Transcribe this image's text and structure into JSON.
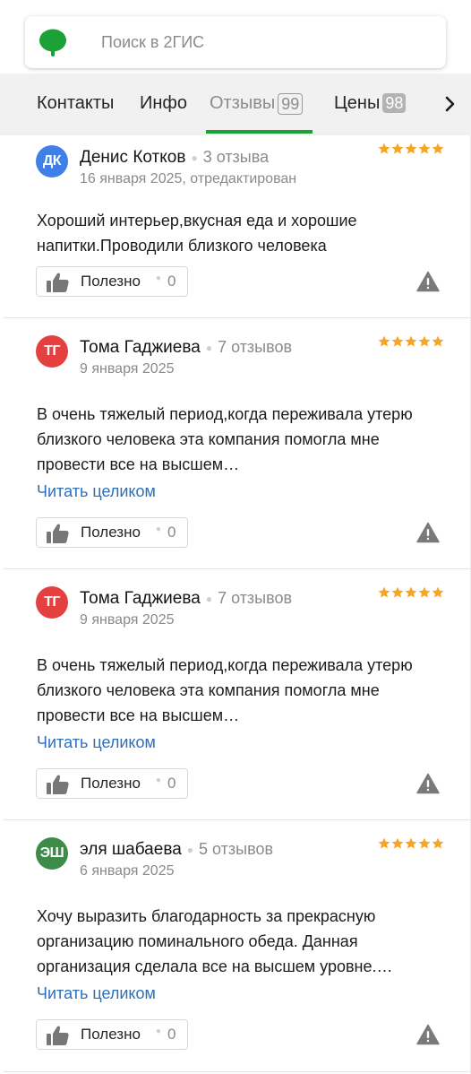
{
  "search": {
    "placeholder": "Поиск в 2ГИС"
  },
  "tabs": [
    {
      "label": "Контакты",
      "count": ""
    },
    {
      "label": "Инфо",
      "count": ""
    },
    {
      "label": "Отзывы",
      "count": "99",
      "active": true
    },
    {
      "label": "Цены",
      "count": "98"
    }
  ],
  "colors": {
    "brand_green": "#1ba136",
    "star": "#f5a623",
    "link": "#2b6fbf",
    "avatar_blue": "#3f7fe8",
    "avatar_red": "#e54040",
    "avatar_green": "#3d8b49"
  },
  "helpful_label": "Полезно",
  "reviews": [
    {
      "initials": "ДК",
      "avatar_color": "#3f7fe8",
      "author": "Денис Котков",
      "review_count": "3 отзыва",
      "date": "16 января 2025, отредактирован",
      "rating": 5,
      "text": "Хороший интерьер,вкусная еда и хорошие напитки.Проводили близкого человека",
      "read_more": "",
      "helpful_count": "0"
    },
    {
      "initials": "ТГ",
      "avatar_color": "#e54040",
      "author": "Тома Гаджиева",
      "review_count": "7 отзывов",
      "date": "9 января 2025",
      "rating": 5,
      "text": "В очень тяжелый период,когда переживала утерю близкого человека эта компания помогла мне провести все на высшем…",
      "read_more": "Читать целиком",
      "helpful_count": "0"
    },
    {
      "initials": "ТГ",
      "avatar_color": "#e54040",
      "author": "Тома Гаджиева",
      "review_count": "7 отзывов",
      "date": "9 января 2025",
      "rating": 5,
      "text": "В очень тяжелый период,когда переживала утерю близкого человека эта компания помогла мне провести все на высшем…",
      "read_more": "Читать целиком",
      "helpful_count": "0"
    },
    {
      "initials": "ЭШ",
      "avatar_color": "#3d8b49",
      "author": "эля шабаева",
      "review_count": "5 отзывов",
      "date": "6 января 2025",
      "rating": 5,
      "text": "Хочу выразить благодарность за прекрасную организацию поминального обеда. Данная организация сделала все на высшем уровне.…",
      "read_more": "Читать целиком",
      "helpful_count": "0"
    }
  ]
}
